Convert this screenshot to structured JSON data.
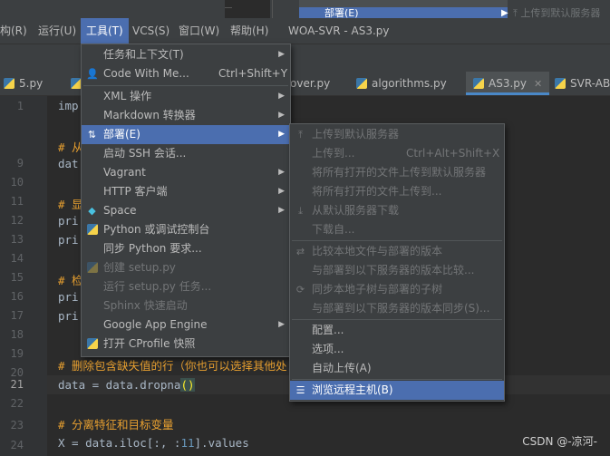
{
  "top_strip": {
    "item": "上传到默认服务器",
    "highlight_item": "部署(E)"
  },
  "menubar": {
    "items": [
      {
        "label": "构(R)"
      },
      {
        "label": "运行(U)"
      },
      {
        "label": "工具(T)"
      },
      {
        "label": "VCS(S)"
      },
      {
        "label": "窗口(W)"
      },
      {
        "label": "帮助(H)"
      }
    ],
    "title": "WOA-SVR - AS3.py"
  },
  "tabs": [
    {
      "label": "5.py"
    },
    {
      "label": "over.py"
    },
    {
      "label": "algorithms.py"
    },
    {
      "label": "AS3.py"
    },
    {
      "label": "SVR-AB"
    }
  ],
  "editor": {
    "line_numbers": [
      "1",
      "9",
      "10",
      "11",
      "12",
      "13",
      "14",
      "15",
      "16",
      "17",
      "18",
      "19",
      "20",
      "21",
      "22",
      "23",
      "24"
    ],
    "current_line": "21",
    "lines": {
      "l1": "imp",
      "l9_hash": "# 从",
      "l10": "dat",
      "l12_hash": "# 显",
      "l13": "pri",
      "l14": "pri",
      "l16_hash": "# 检",
      "l17": "pri",
      "l18": "pri",
      "l20": "# 删除包含缺失值的行（你也可以选择其他处",
      "l21_pre": "data = data.dropna",
      "l21_paren": "()",
      "l23": "# 分离特征和目标变量",
      "l24_pre": "X = data.iloc[:, :",
      "l24_num": "11",
      "l24_post": "].values"
    }
  },
  "tools_menu": {
    "items": [
      {
        "label": "任务和上下文(T)",
        "submenu": true
      },
      {
        "label": "Code With Me...",
        "shortcut": "Ctrl+Shift+Y",
        "icon": "user-icon"
      },
      {
        "label": "XML 操作",
        "submenu": true
      },
      {
        "label": "Markdown 转换器",
        "submenu": true
      },
      {
        "label": "部署(E)",
        "submenu": true,
        "icon": "deploy-icon"
      },
      {
        "label": "启动 SSH 会话..."
      },
      {
        "label": "Vagrant",
        "submenu": true
      },
      {
        "label": "HTTP 客户端",
        "submenu": true
      },
      {
        "label": "Space",
        "submenu": true,
        "icon": "space-icon"
      },
      {
        "label": "Python 或调试控制台",
        "icon": "python-icon"
      },
      {
        "label": "同步 Python 要求..."
      },
      {
        "label": "创建 setup.py",
        "icon": "python-icon"
      },
      {
        "label": "运行 setup.py 任务..."
      },
      {
        "label": "Sphinx 快速启动"
      },
      {
        "label": "Google App Engine",
        "submenu": true
      },
      {
        "label": "打开 CProfile 快照",
        "icon": "profile-icon"
      }
    ]
  },
  "deploy_menu": {
    "items": [
      {
        "label": "上传到默认服务器",
        "icon": "upload-icon"
      },
      {
        "label": "上传到...",
        "shortcut": "Ctrl+Alt+Shift+X"
      },
      {
        "label": "将所有打开的文件上传到默认服务器"
      },
      {
        "label": "将所有打开的文件上传到..."
      },
      {
        "label": "从默认服务器下载",
        "icon": "download-icon"
      },
      {
        "label": "下载自..."
      },
      {
        "label": "比较本地文件与部署的版本",
        "icon": "compare-icon"
      },
      {
        "label": "与部署到以下服务器的版本比较..."
      },
      {
        "label": "同步本地子树与部署的子树",
        "icon": "sync-icon"
      },
      {
        "label": "与部署到以下服务器的版本同步(S)..."
      },
      {
        "label": "配置..."
      },
      {
        "label": "选项..."
      },
      {
        "label": "自动上传(A)"
      },
      {
        "label": "浏览远程主机(B)",
        "icon": "server-icon"
      }
    ]
  },
  "watermark": "CSDN @-凉河-"
}
